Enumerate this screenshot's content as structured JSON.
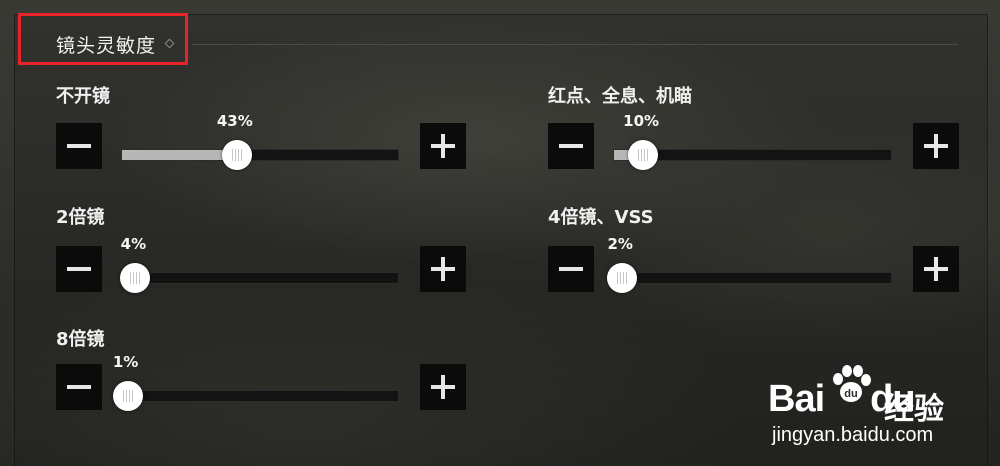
{
  "section": {
    "title": "镜头灵敏度"
  },
  "sliders": [
    {
      "label": "不开镜",
      "percent_text": "43%",
      "value": 43
    },
    {
      "label": "红点、全息、机瞄",
      "percent_text": "10%",
      "value": 10
    },
    {
      "label": "2倍镜",
      "percent_text": "4%",
      "value": 4
    },
    {
      "label": "4倍镜、VSS",
      "percent_text": "2%",
      "value": 2
    },
    {
      "label": "8倍镜",
      "percent_text": "1%",
      "value": 1
    }
  ],
  "icons": {
    "decrease": "minus-icon",
    "increase": "plus-icon"
  },
  "watermark": {
    "logo_text": "Bai",
    "logo_text2": "du",
    "cn_text": "经验",
    "url": "jingyan.baidu.com"
  },
  "colors": {
    "highlight_box": "#e8232a",
    "slider_fill": "#b7b7b7",
    "knob": "#ffffff",
    "button_bg": "#0b0b0b"
  }
}
